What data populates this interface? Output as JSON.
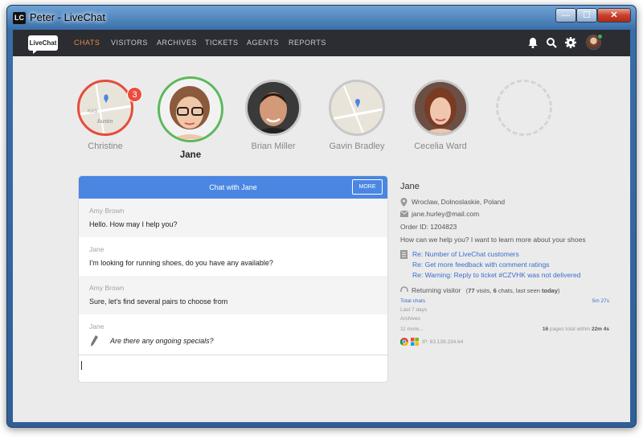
{
  "window": {
    "icon": "LC",
    "title": "Peter - LiveChat",
    "buttons": {
      "minimize": "—",
      "maximize": "☐",
      "close": "✕"
    }
  },
  "nav": {
    "logo": "LiveChat",
    "items": [
      "CHATS",
      "VISITORS",
      "ARCHIVES",
      "TICKETS",
      "AGENTS",
      "REPORTS"
    ],
    "active": "CHATS",
    "icons": [
      "bell-icon",
      "search-icon",
      "gear-icon"
    ],
    "accent": "#e88a49"
  },
  "visitors": [
    {
      "name": "Christine",
      "type": "map",
      "ring": "#e54b3c",
      "badge": "3",
      "map_labels": [
        "KAS",
        "Austin"
      ]
    },
    {
      "name": "Jane",
      "type": "photo",
      "ring": "#5cb85c",
      "selected": true
    },
    {
      "name": "Brian Miller",
      "type": "photo",
      "ring": "#c8c8c8"
    },
    {
      "name": "Gavin Bradley",
      "type": "map",
      "ring": "#c8c8c8"
    },
    {
      "name": "Cecelia Ward",
      "type": "photo",
      "ring": "#c8c8c8"
    }
  ],
  "chat": {
    "title": "Chat with Jane",
    "more": "MORE",
    "header_color": "#4a86e2",
    "messages": [
      {
        "author": "Amy Brown",
        "text": "Hello. How may I help you?"
      },
      {
        "author": "Jane",
        "text": "I'm looking for running shoes, do you have any available?"
      },
      {
        "author": "Amy Brown",
        "text": "Sure, let's find several pairs to choose from"
      }
    ],
    "typing": {
      "author": "Jane",
      "text": "Are there any ongoing specials?"
    },
    "input_value": ""
  },
  "info": {
    "name": "Jane",
    "location": "Wroclaw, Dolnoslaskie, Poland",
    "email": "jane.hurley@mail.com",
    "order": "Order ID: 1204823",
    "question": "How can we help you? I want to learn more about your shoes",
    "tickets": [
      "Re: Number of LiveChat customers",
      "Re: Get more feedback with comment ratings",
      "Re: Warning: Reply to ticket #CZVHK was not delivered"
    ],
    "returning": "Returning visitor",
    "returning_stats_a": "(",
    "visits": "77",
    "returning_stats_b": " visits, ",
    "chats": "6",
    "returning_stats_c": " chats, last seen ",
    "last_seen": "today",
    "returning_stats_d": ")",
    "total_chats_label": "Total chats",
    "total_chats_time": "5m 27s",
    "last_days": "Last 7 days",
    "archives": "Archives",
    "more": "11 more...",
    "pages_count": "16",
    "pages_text": " pages total within ",
    "pages_time": "22m 4s",
    "ip": "IP: 63.139.234.64"
  }
}
